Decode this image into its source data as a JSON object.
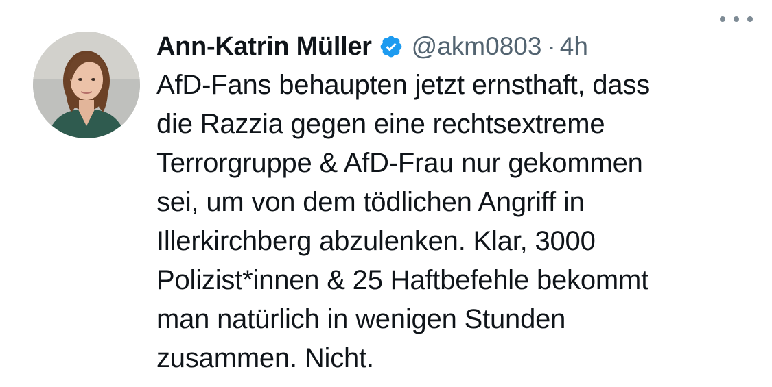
{
  "tweet": {
    "author_name": "Ann-Katrin Müller",
    "handle": "@akm0803",
    "separator": "·",
    "time": "4h",
    "verified": true,
    "text": "AfD-Fans behaupten jetzt ernsthaft, dass\ndie Razzia gegen eine rechtsextreme\nTerrorgruppe & AfD-Frau nur gekommen\nsei, um von dem tödlichen Angriff in\nIllerkirchberg abzulenken. Klar, 3000\nPolizist*innen & 25 Haftbefehle bekommt\nman natürlich in wenigen Stunden\nzusammen. Nicht."
  },
  "icons": {
    "verified": "verified-badge-icon",
    "more": "more-options-icon",
    "avatar": "profile-avatar"
  },
  "colors": {
    "text_primary": "#0f1419",
    "text_secondary": "#536471",
    "verified_blue": "#1d9bf0",
    "background": "#ffffff"
  }
}
